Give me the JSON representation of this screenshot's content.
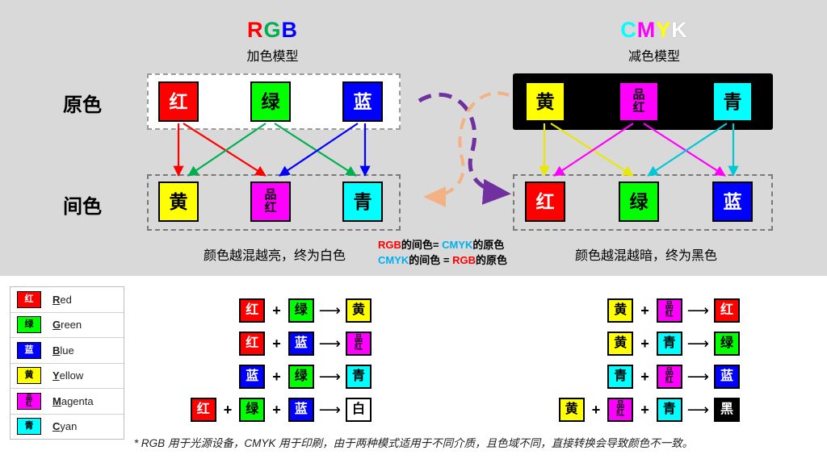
{
  "panels": {
    "top_bg": "#d9d9d9",
    "bottom_bg": "#ffffff"
  },
  "rgb": {
    "title_letters": [
      {
        "ch": "R",
        "color": "#ff0000"
      },
      {
        "ch": "G",
        "color": "#00b050"
      },
      {
        "ch": "B",
        "color": "#0000ff"
      }
    ],
    "title": "RGB",
    "subtitle": "加色模型",
    "primaries": [
      {
        "label": "红",
        "bg": "#ff0000",
        "fg": "#ffffff"
      },
      {
        "label": "绿",
        "bg": "#00ff00",
        "fg": "#000000"
      },
      {
        "label": "蓝",
        "bg": "#0000ff",
        "fg": "#ffffff"
      }
    ],
    "secondaries": [
      {
        "label": "黄",
        "bg": "#ffff00",
        "fg": "#000000"
      },
      {
        "label": "品红",
        "line1": "品",
        "line2": "红",
        "bg": "#ff00ff",
        "fg": "#000000"
      },
      {
        "label": "青",
        "bg": "#00ffff",
        "fg": "#000000"
      }
    ],
    "caption": "颜色越混越亮，终为白色"
  },
  "cmyk": {
    "title": "CMYK",
    "title_letters": [
      {
        "ch": "C",
        "color": "#00ffff"
      },
      {
        "ch": "M",
        "color": "#ff00ff"
      },
      {
        "ch": "Y",
        "color": "#ffff00"
      },
      {
        "ch": "K",
        "color": "#ffffff"
      }
    ],
    "subtitle": "减色模型",
    "primaries": [
      {
        "label": "黄",
        "bg": "#ffff00",
        "fg": "#000000"
      },
      {
        "label": "品红",
        "line1": "品",
        "line2": "红",
        "bg": "#ff00ff",
        "fg": "#000000"
      },
      {
        "label": "青",
        "bg": "#00ffff",
        "fg": "#000000"
      }
    ],
    "secondaries": [
      {
        "label": "红",
        "bg": "#ff0000",
        "fg": "#ffffff"
      },
      {
        "label": "绿",
        "bg": "#00ff00",
        "fg": "#000000"
      },
      {
        "label": "蓝",
        "bg": "#0000ff",
        "fg": "#ffffff"
      }
    ],
    "caption": "颜色越混越暗，终为黑色"
  },
  "row_labels": {
    "primary": "原色",
    "secondary": "间色"
  },
  "middle_notes": {
    "line1_parts": [
      {
        "t": "RGB",
        "c": "#ff0000"
      },
      {
        "t": "的间色= ",
        "c": "#000000"
      },
      {
        "t": "CMYK",
        "c": "#00b0f0"
      },
      {
        "t": "的原色",
        "c": "#000000"
      }
    ],
    "line2_parts": [
      {
        "t": "CMYK",
        "c": "#00b0f0"
      },
      {
        "t": "的间色 = ",
        "c": "#000000"
      },
      {
        "t": "RGB",
        "c": "#ff0000"
      },
      {
        "t": "的原色",
        "c": "#000000"
      }
    ],
    "line1": "RGB的间色= CMYK的原色",
    "line2": "CMYK的间色 = RGB的原色"
  },
  "legend": [
    {
      "sw": "红",
      "bg": "#ff0000",
      "fg": "#ffffff",
      "initial": "R",
      "rest": "ed"
    },
    {
      "sw": "绿",
      "bg": "#00ff00",
      "fg": "#000000",
      "initial": "G",
      "rest": "reen"
    },
    {
      "sw": "蓝",
      "bg": "#0000ff",
      "fg": "#ffffff",
      "initial": "B",
      "rest": "lue"
    },
    {
      "sw": "黄",
      "bg": "#ffff00",
      "fg": "#000000",
      "initial": "Y",
      "rest": "ellow"
    },
    {
      "sw": "品红",
      "l1": "品",
      "l2": "红",
      "bg": "#ff00ff",
      "fg": "#000000",
      "initial": "M",
      "rest": "agenta"
    },
    {
      "sw": "青",
      "bg": "#00ffff",
      "fg": "#000000",
      "initial": "C",
      "rest": "yan"
    }
  ],
  "equations_left": [
    {
      "a": {
        "t": "红",
        "bg": "#ff0000",
        "fg": "#ffffff"
      },
      "b": {
        "t": "绿",
        "bg": "#00ff00",
        "fg": "#000000"
      },
      "r": {
        "t": "黄",
        "bg": "#ffff00",
        "fg": "#000000"
      }
    },
    {
      "a": {
        "t": "红",
        "bg": "#ff0000",
        "fg": "#ffffff"
      },
      "b": {
        "t": "蓝",
        "bg": "#0000ff",
        "fg": "#ffffff"
      },
      "r": {
        "l1": "品",
        "l2": "红",
        "bg": "#ff00ff",
        "fg": "#000000"
      }
    },
    {
      "a": {
        "t": "蓝",
        "bg": "#0000ff",
        "fg": "#ffffff"
      },
      "b": {
        "t": "绿",
        "bg": "#00ff00",
        "fg": "#000000"
      },
      "r": {
        "t": "青",
        "bg": "#00ffff",
        "fg": "#000000"
      }
    },
    {
      "a": {
        "t": "红",
        "bg": "#ff0000",
        "fg": "#ffffff"
      },
      "b": {
        "t": "绿",
        "bg": "#00ff00",
        "fg": "#000000"
      },
      "c": {
        "t": "蓝",
        "bg": "#0000ff",
        "fg": "#ffffff"
      },
      "r": {
        "t": "白",
        "bg": "#ffffff",
        "fg": "#000000"
      }
    }
  ],
  "equations_right": [
    {
      "a": {
        "t": "黄",
        "bg": "#ffff00",
        "fg": "#000000"
      },
      "b": {
        "l1": "品",
        "l2": "红",
        "bg": "#ff00ff",
        "fg": "#000000"
      },
      "r": {
        "t": "红",
        "bg": "#ff0000",
        "fg": "#ffffff"
      }
    },
    {
      "a": {
        "t": "黄",
        "bg": "#ffff00",
        "fg": "#000000"
      },
      "b": {
        "t": "青",
        "bg": "#00ffff",
        "fg": "#000000"
      },
      "r": {
        "t": "绿",
        "bg": "#00ff00",
        "fg": "#000000"
      }
    },
    {
      "a": {
        "t": "青",
        "bg": "#00ffff",
        "fg": "#000000"
      },
      "b": {
        "l1": "品",
        "l2": "红",
        "bg": "#ff00ff",
        "fg": "#000000"
      },
      "r": {
        "t": "蓝",
        "bg": "#0000ff",
        "fg": "#ffffff"
      }
    },
    {
      "a": {
        "t": "黄",
        "bg": "#ffff00",
        "fg": "#000000"
      },
      "b": {
        "l1": "品",
        "l2": "红",
        "bg": "#ff00ff",
        "fg": "#000000"
      },
      "c": {
        "t": "青",
        "bg": "#00ffff",
        "fg": "#000000"
      },
      "r": {
        "t": "黑",
        "bg": "#000000",
        "fg": "#ffffff"
      }
    }
  ],
  "operators": {
    "plus": "+",
    "arrow": "⟶"
  },
  "footnote": "* RGB 用于光源设备，CMYK 用于印刷，由于两种模式适用于不同介质，且色域不同，直接转换会导致颜色不一致。"
}
